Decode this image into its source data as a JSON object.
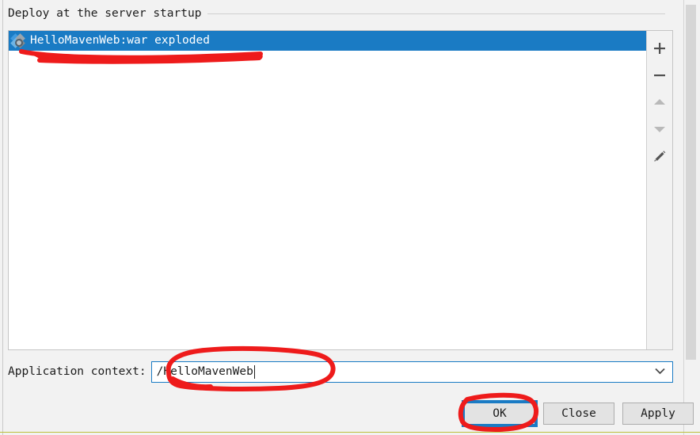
{
  "dialog": {
    "section_title": "Deploy at the server startup"
  },
  "deploy_list": {
    "items": [
      {
        "label": "HelloMavenWeb:war exploded",
        "icon": "artifact-icon",
        "selected": true
      }
    ]
  },
  "tool_strip": {
    "buttons": [
      {
        "name": "add-button",
        "icon": "plus-icon",
        "enabled": true
      },
      {
        "name": "remove-button",
        "icon": "minus-icon",
        "enabled": true
      },
      {
        "name": "move-up-button",
        "icon": "arrow-up-icon",
        "enabled": false
      },
      {
        "name": "move-down-button",
        "icon": "arrow-down-icon",
        "enabled": false
      },
      {
        "name": "edit-button",
        "icon": "pencil-icon",
        "enabled": true
      }
    ]
  },
  "application_context": {
    "label": "Application context:",
    "value": "/HelloMavenWeb",
    "placeholder": "",
    "dropdown_icon": "chevron-down-icon",
    "focused": true
  },
  "buttons": {
    "ok": "OK",
    "close": "Close",
    "apply": "Apply"
  },
  "scrollbar": {
    "name": "dialog-vertical-scrollbar"
  },
  "annotations": {
    "color": "#ee1b1b",
    "marks": [
      {
        "name": "underline-deploy-item",
        "shape": "scribble-underline"
      },
      {
        "name": "circle-application-context",
        "shape": "ellipse"
      },
      {
        "name": "circle-ok-button",
        "shape": "ellipse"
      }
    ]
  },
  "colors": {
    "selection_blue": "#1a7bc4",
    "annotation_red": "#ee1b1b",
    "dialog_background": "#f2f2f2",
    "panel_white": "#ffffff",
    "bottom_rule": "#bcbf3a"
  }
}
